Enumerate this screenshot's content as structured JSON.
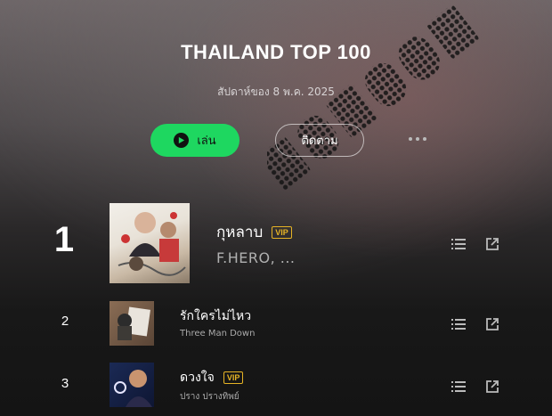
{
  "header": {
    "title": "THAILAND TOP 100",
    "subtitle": "สัปดาห์ของ 8 พ.ค. 2025",
    "play_label": "เล่น",
    "follow_label": "ติดตาม"
  },
  "colors": {
    "accent": "#1ed760",
    "vip": "#e6b325"
  },
  "tracks": [
    {
      "rank": "1",
      "title": "กุหลาบ",
      "artist": "F.HERO, ...",
      "vip": "VIP"
    },
    {
      "rank": "2",
      "title": "รักใครไม่ไหว",
      "artist": "Three Man Down",
      "vip": ""
    },
    {
      "rank": "3",
      "title": "ดวงใจ",
      "artist": "ปราง ปรางทิพย์",
      "vip": "VIP"
    }
  ],
  "icons": {
    "more": "more-icon",
    "list": "list-icon",
    "share": "share-icon",
    "play": "play-icon"
  }
}
